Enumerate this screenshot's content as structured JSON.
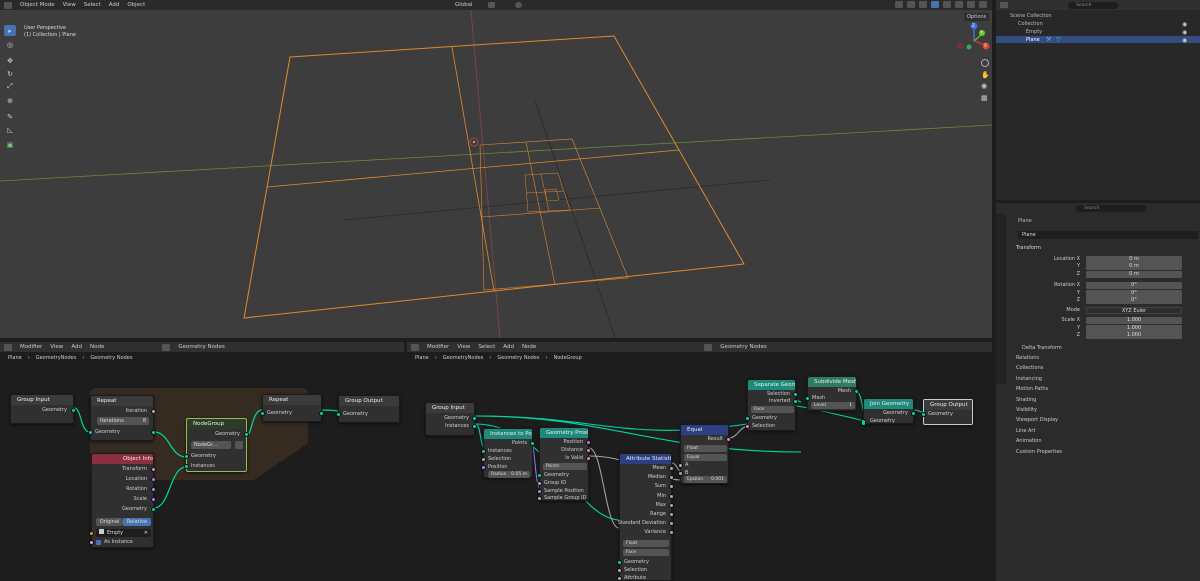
{
  "viewport": {
    "menu": [
      "Object Mode",
      "View",
      "Select",
      "Add",
      "Object"
    ],
    "transform_orient": "Global",
    "options": "Options",
    "perspective": "User Perspective",
    "context": "(1) Collection | Plane",
    "gizmo": {
      "z": "Z",
      "y": "Y",
      "x": "X"
    }
  },
  "outliner": {
    "search": "Search",
    "scene_collection": "Scene Collection",
    "collection": "Collection",
    "items": [
      "Empty",
      "Plane"
    ]
  },
  "properties": {
    "search": "Search",
    "object_name": "Plane",
    "object_field": "Plane",
    "transform": "Transform",
    "location_x": "Location X",
    "loc": [
      "0 m",
      "0 m",
      "0 m"
    ],
    "rotation_x": "Rotation X",
    "rot": [
      "0°",
      "0°",
      "0°"
    ],
    "mode_label": "Mode",
    "mode": "XYZ Euler",
    "scale_x": "Scale X",
    "scale": [
      "1.000",
      "1.000",
      "1.000"
    ],
    "y": "Y",
    "z": "Z",
    "delta": "Delta Transform",
    "sections": [
      "Relations",
      "Collections",
      "Instancing",
      "Motion Paths",
      "Shading",
      "Visibility",
      "Viewport Display",
      "Line Art",
      "Animation",
      "Custom Properties"
    ]
  },
  "left_editor": {
    "menu": [
      "Modifier",
      "View",
      "Add",
      "Node"
    ],
    "tree": "Geometry Nodes",
    "breadcrumb": [
      "Plane",
      "GeometryNodes",
      "Geometry Nodes"
    ],
    "nodes": {
      "group_input": "Group Input",
      "geometry": "Geometry",
      "repeat": "Repeat",
      "iteration": "Iteration",
      "iterations": "Iterations",
      "iterations_val": "8",
      "nodegroup": "NodeGroup",
      "nodegroup_field": "NodeGr...",
      "instances": "Instances",
      "repeat_out": "Repeat",
      "group_output": "Group Output",
      "object_info": "Object Info",
      "transform": "Transform",
      "location": "Location",
      "rotation": "Rotation",
      "scale": "Scale",
      "original": "Original",
      "relative": "Relative",
      "empty": "Empty",
      "as_instance": "As Instance"
    }
  },
  "right_editor": {
    "menu": [
      "Modifier",
      "View",
      "Select",
      "Add",
      "Node"
    ],
    "tree": "Geometry Nodes",
    "breadcrumb": [
      "Plane",
      "GeometryNodes",
      "Geometry Nodes",
      "NodeGroup"
    ],
    "nodes": {
      "group_input": "Group Input",
      "geometry": "Geometry",
      "instances": "Instances",
      "itp": "Instances to Points",
      "points": "Points",
      "selection": "Selection",
      "position": "Position",
      "radius": "Radius",
      "radius_val": "0.05 m",
      "gp": "Geometry Proximity",
      "distance": "Distance",
      "is_valid": "Is Valid",
      "points_field": "Points",
      "group_id": "Group ID",
      "sample_position": "Sample Position",
      "sample_group_id": "Sample Group ID",
      "attr": "Attribute Statistic",
      "mean": "Mean",
      "median": "Median",
      "sum": "Sum",
      "min": "Min",
      "max": "Max",
      "range": "Range",
      "std": "Standard Deviation",
      "variance": "Variance",
      "float": "Float",
      "face": "Face",
      "attribute": "Attribute",
      "equal": "Equal",
      "result": "Result",
      "a": "A",
      "b": "B",
      "epsilon": "Epsilon",
      "epsilon_val": "0.001",
      "sep": "Separate Geometry",
      "inverted": "Inverted",
      "sub": "Subdivide Mesh",
      "mesh": "Mesh",
      "level": "Level",
      "level_val": "1",
      "join": "Join Geometry",
      "group_output": "Group Output"
    }
  }
}
